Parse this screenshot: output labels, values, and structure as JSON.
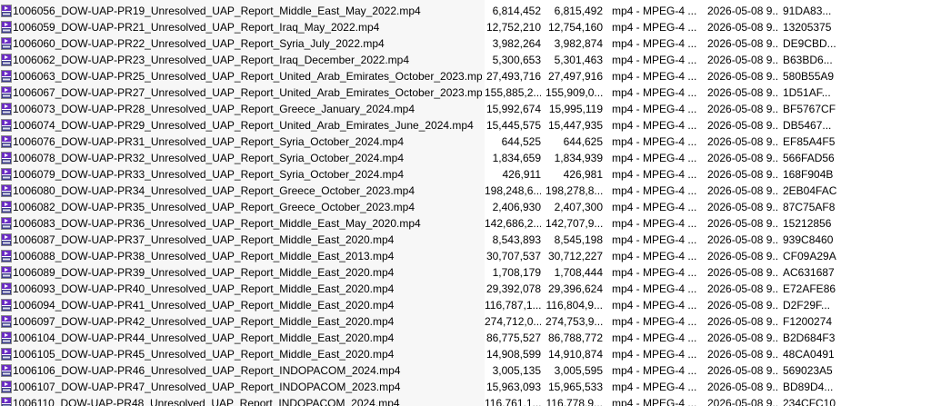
{
  "colors": {
    "list_background": "#f7f7f7",
    "icon_purple": "#6a2bc4",
    "icon_body": "#ffffff"
  },
  "file_icon": "video-file-icon",
  "rows": [
    {
      "name": "1006056_DOW-UAP-PR19_Unresolved_UAP_Report_Middle_East_May_2022.mp4",
      "size": "6,814,452",
      "packed": "6,815,492",
      "type": "mp4 - MPEG-4 ...",
      "modified": "2026-05-08 9...",
      "crc": "91DA83..."
    },
    {
      "name": "1006059_DOW-UAP-PR21_Unresolved_UAP_Report_Iraq_May_2022.mp4",
      "size": "12,752,210",
      "packed": "12,754,160",
      "type": "mp4 - MPEG-4 ...",
      "modified": "2026-05-08 9...",
      "crc": "13205375"
    },
    {
      "name": "1006060_DOW-UAP-PR22_Unresolved_UAP_Report_Syria_July_2022.mp4",
      "size": "3,982,264",
      "packed": "3,982,874",
      "type": "mp4 - MPEG-4 ...",
      "modified": "2026-05-08 9...",
      "crc": "DE9CBD..."
    },
    {
      "name": "1006062_DOW-UAP-PR23_Unresolved_UAP_Report_Iraq_December_2022.mp4",
      "size": "5,300,653",
      "packed": "5,301,463",
      "type": "mp4 - MPEG-4 ...",
      "modified": "2026-05-08 9...",
      "crc": "B63BD6..."
    },
    {
      "name": "1006063_DOW-UAP-PR25_Unresolved_UAP_Report_United_Arab_Emirates_October_2023.mp4",
      "size": "27,493,716",
      "packed": "27,497,916",
      "type": "mp4 - MPEG-4 ...",
      "modified": "2026-05-08 9...",
      "crc": "580B55A9"
    },
    {
      "name": "1006067_DOW-UAP-PR27_Unresolved_UAP_Report_United_Arab_Emirates_October_2023.mp4",
      "size": "155,885,2...",
      "packed": "155,909,0...",
      "type": "mp4 - MPEG-4 ...",
      "modified": "2026-05-08 9...",
      "crc": "1D51AF..."
    },
    {
      "name": "1006073_DOW-UAP-PR28_Unresolved_UAP_Report_Greece_January_2024.mp4",
      "size": "15,992,674",
      "packed": "15,995,119",
      "type": "mp4 - MPEG-4 ...",
      "modified": "2026-05-08 9...",
      "crc": "BF5767CF"
    },
    {
      "name": "1006074_DOW-UAP-PR29_Unresolved_UAP_Report_United_Arab_Emirates_June_2024.mp4",
      "size": "15,445,575",
      "packed": "15,447,935",
      "type": "mp4 - MPEG-4 ...",
      "modified": "2026-05-08 9...",
      "crc": "DB5467..."
    },
    {
      "name": "1006076_DOW-UAP-PR31_Unresolved_UAP_Report_Syria_October_2024.mp4",
      "size": "644,525",
      "packed": "644,625",
      "type": "mp4 - MPEG-4 ...",
      "modified": "2026-05-08 9...",
      "crc": "EF85A4F5"
    },
    {
      "name": "1006078_DOW-UAP-PR32_Unresolved_UAP_Report_Syria_October_2024.mp4",
      "size": "1,834,659",
      "packed": "1,834,939",
      "type": "mp4 - MPEG-4 ...",
      "modified": "2026-05-08 9...",
      "crc": "566FAD56"
    },
    {
      "name": "1006079_DOW-UAP-PR33_Unresolved_UAP_Report_Syria_October_2024.mp4",
      "size": "426,911",
      "packed": "426,981",
      "type": "mp4 - MPEG-4 ...",
      "modified": "2026-05-08 9...",
      "crc": "168F904B"
    },
    {
      "name": "1006080_DOW-UAP-PR34_Unresolved_UAP_Report_Greece_October_2023.mp4",
      "size": "198,248,6...",
      "packed": "198,278,8...",
      "type": "mp4 - MPEG-4 ...",
      "modified": "2026-05-08 9...",
      "crc": "2EB04FAC"
    },
    {
      "name": "1006082_DOW-UAP-PR35_Unresolved_UAP_Report_Greece_October_2023.mp4",
      "size": "2,406,930",
      "packed": "2,407,300",
      "type": "mp4 - MPEG-4 ...",
      "modified": "2026-05-08 9...",
      "crc": "87C75AF8"
    },
    {
      "name": "1006083_DOW-UAP-PR36_Unresolved_UAP_Report_Middle_East_May_2020.mp4",
      "size": "142,686,2...",
      "packed": "142,707,9...",
      "type": "mp4 - MPEG-4 ...",
      "modified": "2026-05-08 9...",
      "crc": "15212856"
    },
    {
      "name": "1006087_DOW-UAP-PR37_Unresolved_UAP_Report_Middle_East_2020.mp4",
      "size": "8,543,893",
      "packed": "8,545,198",
      "type": "mp4 - MPEG-4 ...",
      "modified": "2026-05-08 9...",
      "crc": "939C8460"
    },
    {
      "name": "1006088_DOW-UAP-PR38_Unresolved_UAP_Report_Middle_East_2013.mp4",
      "size": "30,707,537",
      "packed": "30,712,227",
      "type": "mp4 - MPEG-4 ...",
      "modified": "2026-05-08 9...",
      "crc": "CF09A29A"
    },
    {
      "name": "1006089_DOW-UAP-PR39_Unresolved_UAP_Report_Middle_East_2020.mp4",
      "size": "1,708,179",
      "packed": "1,708,444",
      "type": "mp4 - MPEG-4 ...",
      "modified": "2026-05-08 9...",
      "crc": "AC631687"
    },
    {
      "name": "1006093_DOW-UAP-PR40_Unresolved_UAP_Report_Middle_East_2020.mp4",
      "size": "29,392,078",
      "packed": "29,396,624",
      "type": "mp4 - MPEG-4 ...",
      "modified": "2026-05-08 9...",
      "crc": "E72AFE86"
    },
    {
      "name": "1006094_DOW-UAP-PR41_Unresolved_UAP_Report_Middle_East_2020.mp4",
      "size": "116,787,1...",
      "packed": "116,804,9...",
      "type": "mp4 - MPEG-4 ...",
      "modified": "2026-05-08 9...",
      "crc": "D2F29F..."
    },
    {
      "name": "1006097_DOW-UAP-PR42_Unresolved_UAP_Report_Middle_East_2020.mp4",
      "size": "274,712,0...",
      "packed": "274,753,9...",
      "type": "mp4 - MPEG-4 ...",
      "modified": "2026-05-08 9...",
      "crc": "F1200274"
    },
    {
      "name": "1006104_DOW-UAP-PR44_Unresolved_UAP_Report_Middle_East_2020.mp4",
      "size": "86,775,527",
      "packed": "86,788,772",
      "type": "mp4 - MPEG-4 ...",
      "modified": "2026-05-08 9...",
      "crc": "B2D684F3"
    },
    {
      "name": "1006105_DOW-UAP-PR45_Unresolved_UAP_Report_Middle_East_2020.mp4",
      "size": "14,908,599",
      "packed": "14,910,874",
      "type": "mp4 - MPEG-4 ...",
      "modified": "2026-05-08 9...",
      "crc": "48CA0491"
    },
    {
      "name": "1006106_DOW-UAP-PR46_Unresolved_UAP_Report_INDOPACOM_2024.mp4",
      "size": "3,005,135",
      "packed": "3,005,595",
      "type": "mp4 - MPEG-4 ...",
      "modified": "2026-05-08 9...",
      "crc": "569023A5"
    },
    {
      "name": "1006107_DOW-UAP-PR47_Unresolved_UAP_Report_INDOPACOM_2023.mp4",
      "size": "15,963,093",
      "packed": "15,965,533",
      "type": "mp4 - MPEG-4 ...",
      "modified": "2026-05-08 9...",
      "crc": "BD89D4..."
    },
    {
      "name": "1006110_DOW-UAP-PR48_Unresolved_UAP_Report_INDOPACOM_2024.mp4",
      "size": "116,761,1...",
      "packed": "116,778,9...",
      "type": "mp4 - MPEG-4 ...",
      "modified": "2026-05-08 9...",
      "crc": "234CFC10"
    }
  ]
}
